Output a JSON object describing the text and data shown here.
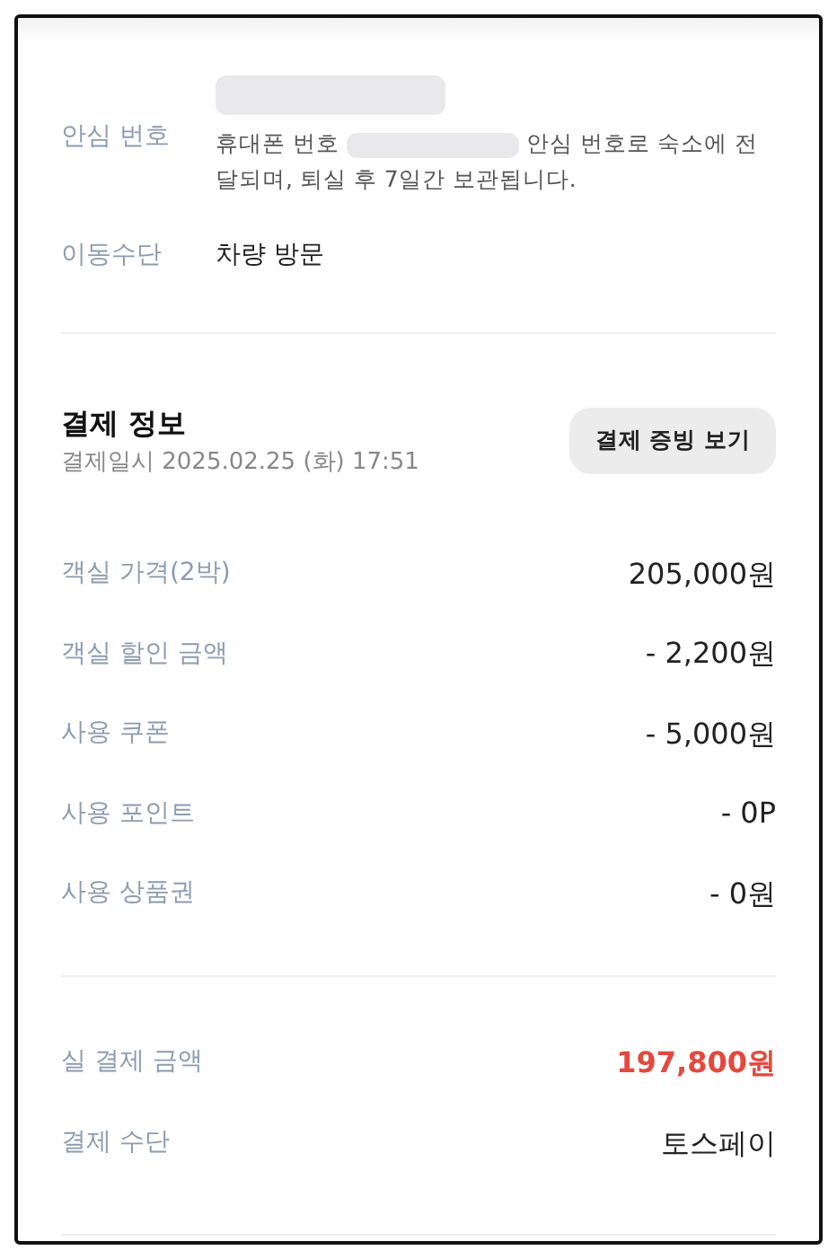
{
  "contact": {
    "safe_number": {
      "label": "안심 번호",
      "note_before": "휴대폰 번호",
      "note_after": "안심 번호로 숙소에 전달되며, 퇴실 후 7일간 보관됩니다."
    },
    "transport": {
      "label": "이동수단",
      "value": "차량 방문"
    }
  },
  "payment": {
    "title": "결제 정보",
    "date": "결제일시 2025.02.25 (화) 17:51",
    "receipt_button": "결제 증빙 보기",
    "items": [
      {
        "label": "객실 가격(2박)",
        "value": "205,000원"
      },
      {
        "label": "객실 할인 금액",
        "value": "- 2,200원"
      },
      {
        "label": "사용 쿠폰",
        "value": "- 5,000원"
      },
      {
        "label": "사용 포인트",
        "value": "- 0P"
      },
      {
        "label": "사용 상품권",
        "value": "- 0원"
      }
    ],
    "summary": [
      {
        "label": "실 결제 금액",
        "value": "197,800원",
        "kind": "total"
      },
      {
        "label": "결제 수단",
        "value": "토스페이",
        "kind": "plain"
      }
    ]
  }
}
